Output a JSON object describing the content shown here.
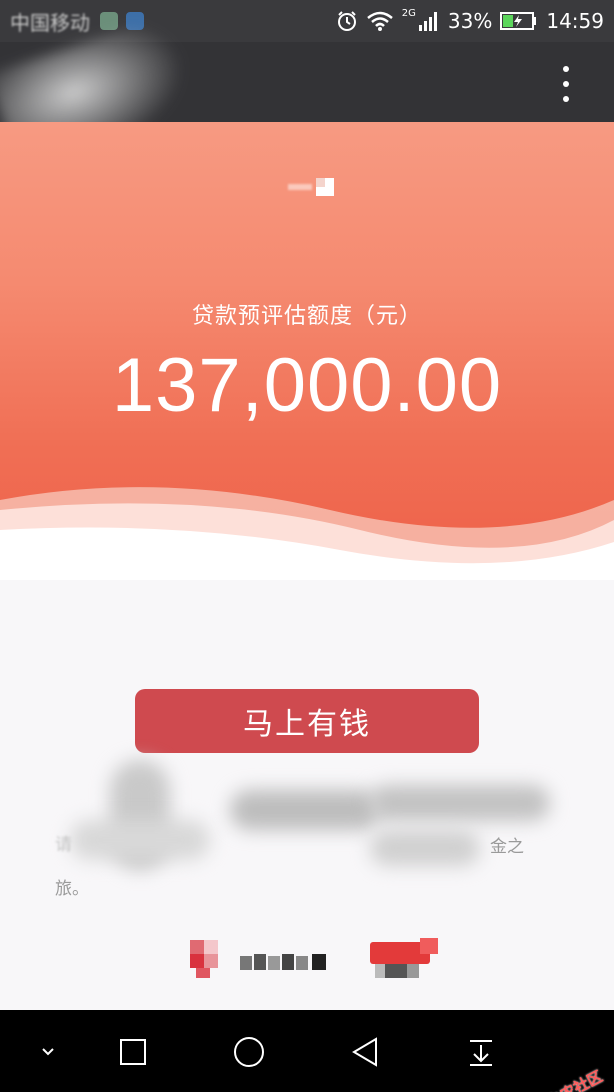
{
  "status_bar": {
    "carrier": "中国移动",
    "network_badge": "2G",
    "battery_percent": "33%",
    "time": "14:59",
    "icons": [
      "alarm-icon",
      "wifi-icon",
      "signal-icon",
      "battery-charging-icon"
    ]
  },
  "app_bar": {
    "menu_icon": "more-vert-icon"
  },
  "hero": {
    "estimate_label": "贷款预评估额度（元）",
    "estimate_value": "137,000.00"
  },
  "cta": {
    "label": "马上有钱"
  },
  "description": {
    "fragment_left": "请",
    "fragment_right": "金之",
    "fragment_last": "旅。"
  },
  "nav_bar": {
    "icons": [
      "collapse-icon",
      "recents-icon",
      "home-icon",
      "back-icon",
      "notification-pull-icon"
    ]
  },
  "watermark": {
    "text": "卡农社区"
  },
  "colors": {
    "hero_top": "#f79a82",
    "hero_bottom": "#ee6048",
    "cta_bg": "#cf4a4f",
    "status_bg": "#3a3a3d",
    "nav_bg": "#000000"
  }
}
